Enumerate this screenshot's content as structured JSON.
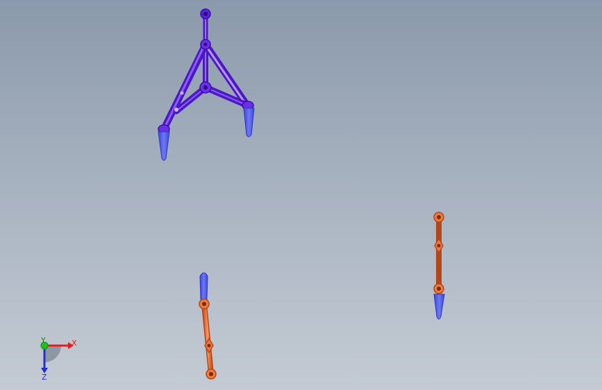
{
  "viewport": {
    "background_top": "#8a99ab",
    "background_bottom": "#c4cbd4"
  },
  "parts": {
    "a_arm_color": "#6a2fe6",
    "a_arm_highlight": "#a07cf5",
    "link_color": "#f07a3a",
    "link_outline": "#b3471a",
    "bushing_color": "#5060e8"
  },
  "triad": {
    "x_label": "X",
    "y_label": "Y",
    "z_label": "Z",
    "x_color": "#e02020",
    "y_color": "#20c020",
    "z_color": "#2030d0"
  }
}
